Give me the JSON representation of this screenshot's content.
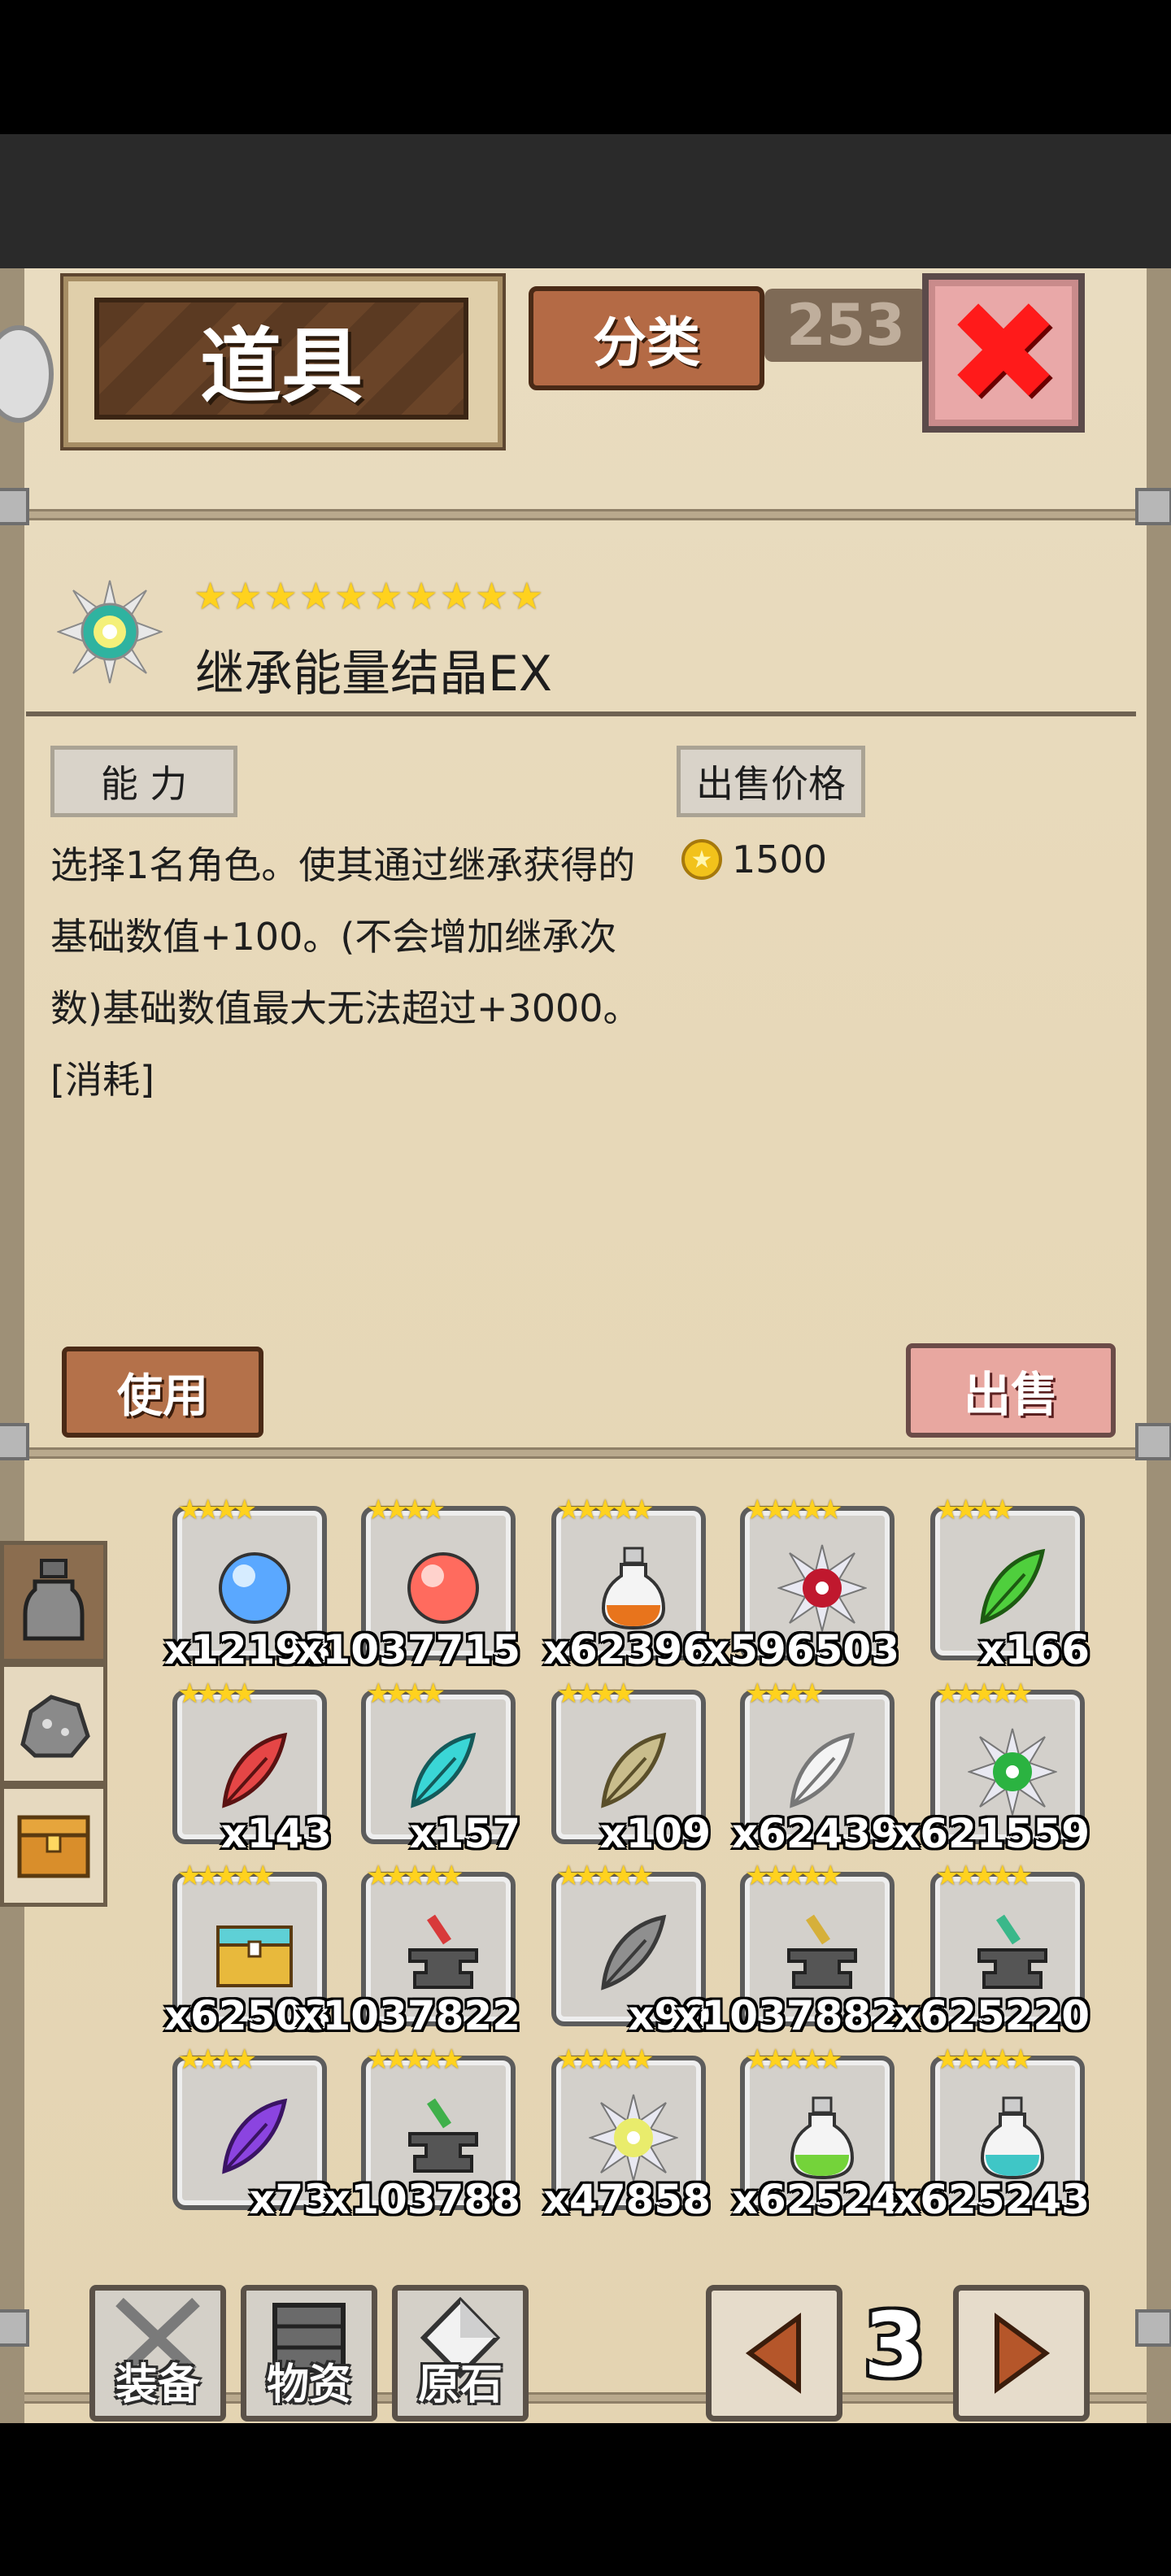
{
  "header": {
    "title": "道具",
    "sort_label": "分类",
    "background_number": "253"
  },
  "item": {
    "name": "继承能量结晶EX",
    "star_count": 10,
    "ability_label": "能 力",
    "price_label": "出售价格",
    "price": "1500",
    "description": "选择1名角色。使其通过继承获得的基础数值+100。(不会增加继承次数)基础数值最大无法超过+3000。[消耗]"
  },
  "actions": {
    "use_label": "使用",
    "sell_label": "出售"
  },
  "inventory": [
    {
      "count": "x12193",
      "icon": "blue-orb-icon",
      "stars": 4
    },
    {
      "count": "x1037715",
      "icon": "red-orb-icon",
      "stars": 4
    },
    {
      "count": "x62396",
      "icon": "orange-potion-icon",
      "stars": 5
    },
    {
      "count": "x596503",
      "icon": "red-crystal-burst-icon",
      "stars": 5
    },
    {
      "count": "x166",
      "icon": "green-feather-icon",
      "stars": 4
    },
    {
      "count": "x143",
      "icon": "red-feather-icon",
      "stars": 4
    },
    {
      "count": "x157",
      "icon": "cyan-feather-icon",
      "stars": 4
    },
    {
      "count": "x109",
      "icon": "tan-feather-icon",
      "stars": 4
    },
    {
      "count": "x62439",
      "icon": "white-feather-icon",
      "stars": 4
    },
    {
      "count": "x621559",
      "icon": "green-crystal-burst-icon",
      "stars": 5
    },
    {
      "count": "x62503",
      "icon": "treasure-chest-icon",
      "stars": 5
    },
    {
      "count": "x1037822",
      "icon": "red-anvil-icon",
      "stars": 5
    },
    {
      "count": "x90",
      "icon": "gray-feather-icon",
      "stars": 5
    },
    {
      "count": "x1037882",
      "icon": "gold-anvil-icon",
      "stars": 5
    },
    {
      "count": "x625220",
      "icon": "dark-anvil-icon",
      "stars": 5
    },
    {
      "count": "x73",
      "icon": "purple-feather-icon",
      "stars": 4
    },
    {
      "count": "x103788",
      "icon": "green-hammer-anvil-icon",
      "stars": 5
    },
    {
      "count": "x47858",
      "icon": "inherit-crystal-icon",
      "stars": 5
    },
    {
      "count": "x62524",
      "icon": "green-potion-icon",
      "stars": 5
    },
    {
      "count": "x625243",
      "icon": "teal-potion-icon",
      "stars": 5
    }
  ],
  "categories": [
    {
      "icon": "bottle-icon",
      "active": true
    },
    {
      "icon": "ore-rock-icon",
      "active": false
    },
    {
      "icon": "chest-icon",
      "active": false
    }
  ],
  "nav": {
    "equip_label": "装备",
    "materials_label": "物资",
    "ore_label": "原石",
    "page": "3"
  },
  "colors": {
    "parchment": "#e7d8b8",
    "wood": "#b46a45",
    "star": "#ffd21e",
    "close": "#ff1a1a"
  }
}
